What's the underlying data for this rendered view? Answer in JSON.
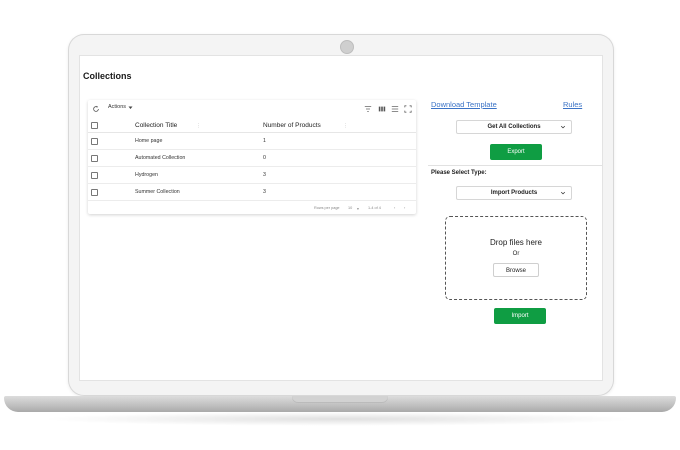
{
  "page": {
    "title": "Collections"
  },
  "table": {
    "toolbar": {
      "actions_label": "Actions"
    },
    "columns": [
      "Collection Title",
      "Number of Products"
    ],
    "rows": [
      {
        "title": "Home page",
        "count": "1"
      },
      {
        "title": "Automated Collection",
        "count": "0"
      },
      {
        "title": "Hydrogen",
        "count": "3"
      },
      {
        "title": "Summer Collection",
        "count": "3"
      }
    ],
    "footer": {
      "rows_per_page_label": "Rows per page",
      "rows_per_page_value": "10",
      "range": "1-4 of 4"
    }
  },
  "right_panel": {
    "download_template_label": "Download Template",
    "rules_label": "Rules",
    "export_select_value": "Get All Collections",
    "export_button_label": "Export",
    "select_type_label": "Please Select Type:",
    "import_select_value": "Import Products",
    "dropzone": {
      "title": "Drop files here",
      "or_label": "Or",
      "browse_label": "Browse"
    },
    "import_button_label": "Import"
  },
  "colors": {
    "accent_green": "#0f9d43",
    "link_blue": "#3b73c6"
  },
  "icons": [
    "refresh-icon",
    "chevron-down-icon",
    "filter-icon",
    "columns-icon",
    "density-icon",
    "fullscreen-icon",
    "sort-icon",
    "first-page-icon",
    "prev-page-icon",
    "next-page-icon",
    "last-page-icon"
  ]
}
